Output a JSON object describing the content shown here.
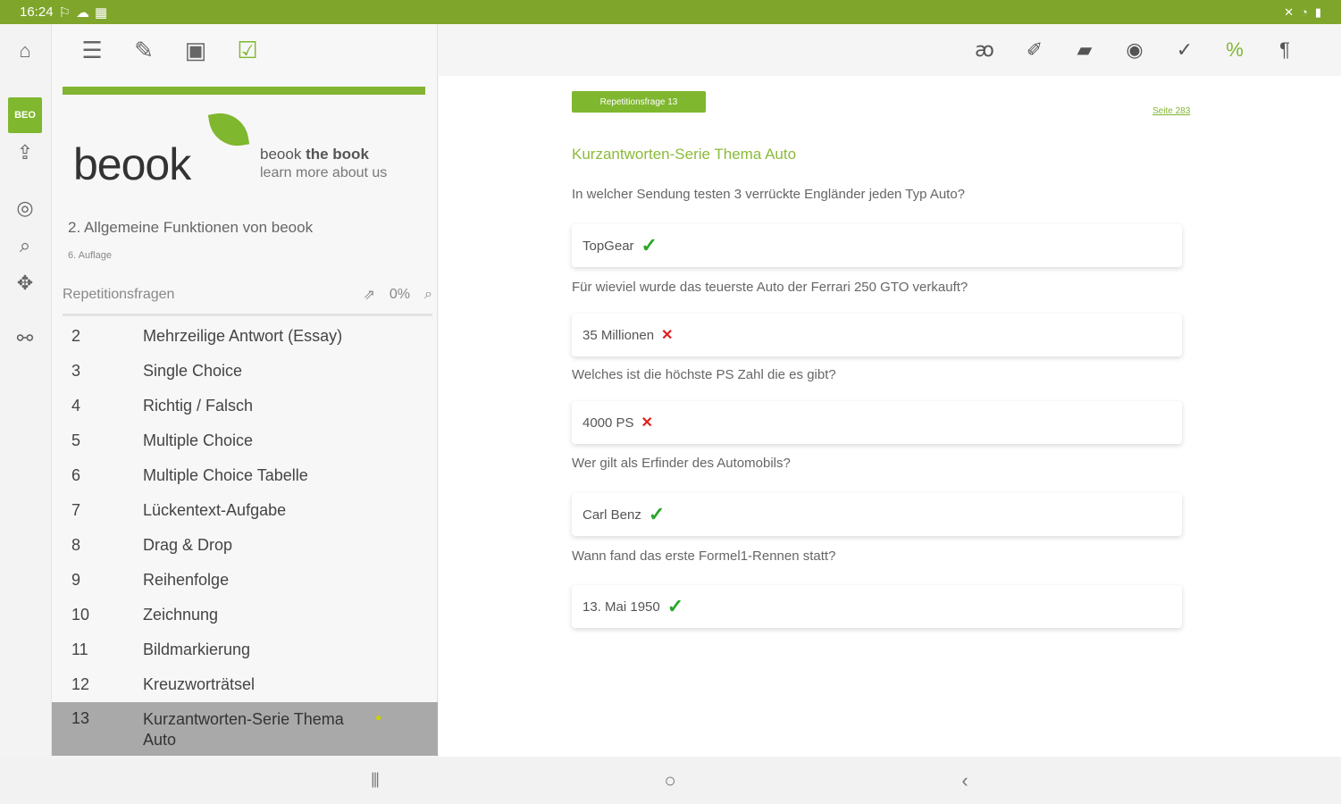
{
  "status": {
    "time": "16:24",
    "left_icons": [
      "wifi-icon",
      "cloud-icon",
      "grid-icon"
    ],
    "right_icons": [
      "mute-icon",
      "wifi-signal-icon",
      "battery-icon"
    ]
  },
  "rail": {
    "beo_label": "BEO"
  },
  "sidebar": {
    "tagline_brand": "beook",
    "tagline_bold": "the book",
    "tagline_sub": "learn more about us",
    "book_title": "2. Allgemeine Funktionen von beook",
    "edition": "6. Auflage",
    "section_label": "Repetitionsfragen",
    "progress": "0%",
    "items": [
      {
        "num": "2",
        "label": "Mehrzeilige Antwort (Essay)"
      },
      {
        "num": "3",
        "label": "Single Choice"
      },
      {
        "num": "4",
        "label": "Richtig / Falsch"
      },
      {
        "num": "5",
        "label": "Multiple Choice"
      },
      {
        "num": "6",
        "label": "Multiple Choice Tabelle"
      },
      {
        "num": "7",
        "label": "Lückentext-Aufgabe"
      },
      {
        "num": "8",
        "label": "Drag & Drop"
      },
      {
        "num": "9",
        "label": "Reihenfolge"
      },
      {
        "num": "10",
        "label": "Zeichnung"
      },
      {
        "num": "11",
        "label": "Bildmarkierung"
      },
      {
        "num": "12",
        "label": "Kreuzworträtsel"
      },
      {
        "num": "13",
        "label": "Kurzantworten-Serie Thema Auto"
      }
    ]
  },
  "logo_text": "beook",
  "content": {
    "badge": "Repetitionsfrage 13",
    "page_link": "Seite 283",
    "title": "Kurzantworten-Serie Thema Auto",
    "questions": [
      {
        "q": "In welcher Sendung testen 3 verrückte Engländer jeden Typ Auto?",
        "a": "TopGear",
        "correct": true
      },
      {
        "q": "Für wieviel wurde das teuerste Auto der Ferrari 250 GTO verkauft?",
        "a": "35 Millionen",
        "correct": false
      },
      {
        "q": "Welches ist die höchste PS Zahl die es gibt?",
        "a": "4000 PS",
        "correct": false
      },
      {
        "q": "Wer gilt als Erfinder des Automobils?",
        "a": "Carl Benz",
        "correct": true
      },
      {
        "q": "Wann fand das erste Formel1-Rennen statt?",
        "a": "13. Mai 1950",
        "correct": true
      }
    ]
  },
  "marks": {
    "ok": "✓",
    "bad": "✕"
  }
}
